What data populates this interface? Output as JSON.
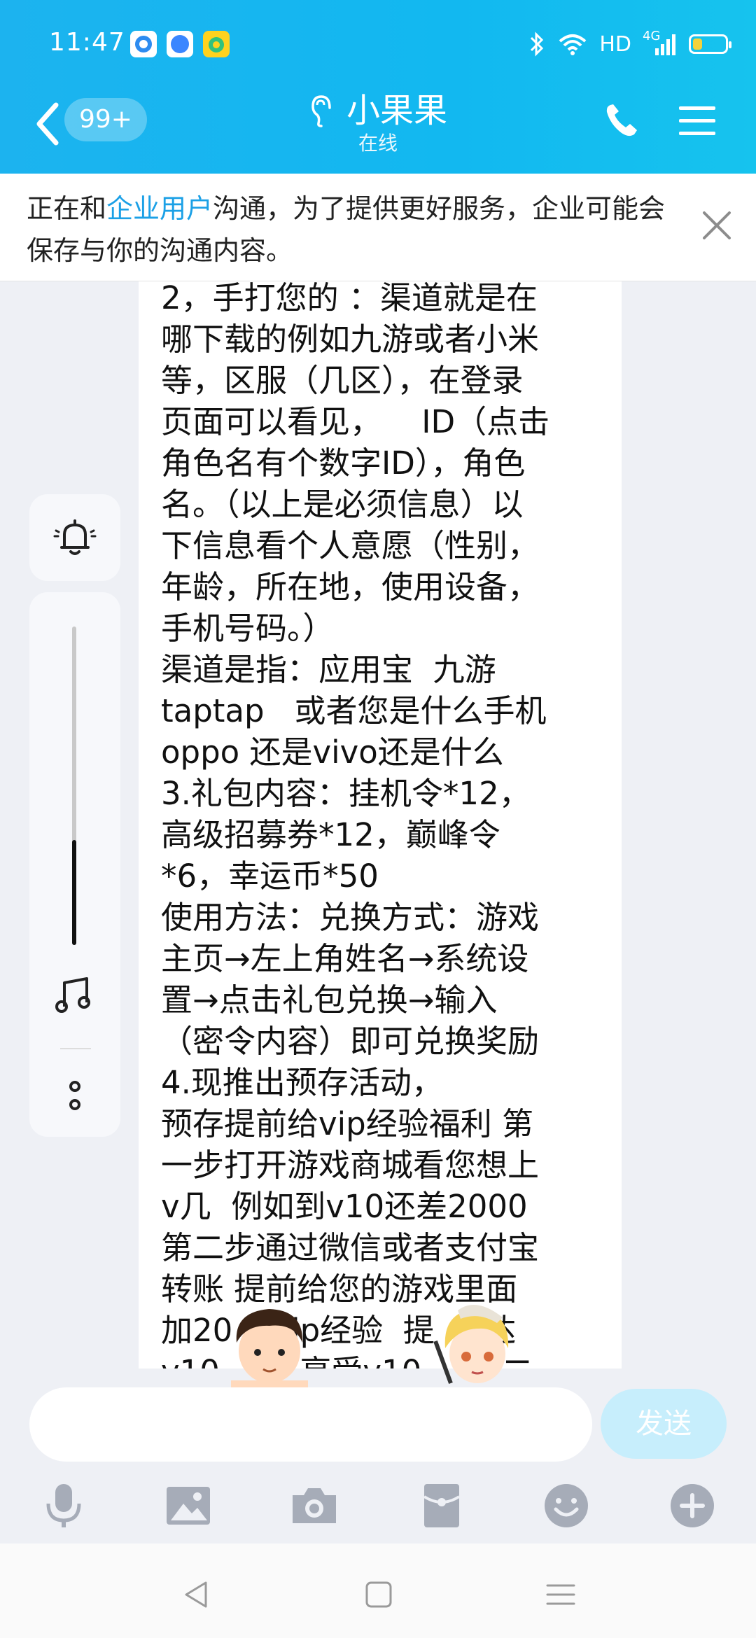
{
  "status_bar": {
    "time": "11:47",
    "hd": "HD",
    "network": "4G",
    "battery_level": 0.3,
    "icons": [
      "browser-app-icon",
      "compass-app-icon",
      "music-app-icon",
      "bluetooth-icon",
      "wifi-icon",
      "signal-icon",
      "battery-icon"
    ]
  },
  "header": {
    "unread_badge": "99+",
    "title": "小果果",
    "subtitle": "在线"
  },
  "notice": {
    "text_before": "正在和",
    "link": "企业用户",
    "text_after": "沟通，为了提供更好服务，企业可能会保存与你的沟通内容。"
  },
  "message": {
    "text": "2，手打您的 ：渠道就是在\n哪下载的例如九游或者小米\n等，区服（几区），在登录\n页面可以看见，    ID（点击\n角色名有个数字ID），角色\n名。（以上是必须信息）以\n下信息看个人意愿（性别，\n年龄，所在地，使用设备，\n手机号码。）\n渠道是指：应用宝  九游\ntaptap   或者您是什么手机\noppo 还是vivo还是什么\n3.礼包内容：挂机令*12，\n高级招募券*12，巅峰令\n*6，幸运币*50\n使用方法：兑换方式：游戏\n主页→左上角姓名→系统设\n置→点击礼包兑换→输入\n（密令内容）即可兑换奖励\n4.现推出预存活动，\n预存提前给vip经验福利 第\n一步打开游戏商城看您想上\nv几  例如到v10还差2000\n第二步通过微信或者支付宝\n转账 提前给您的游戏里面\n加20    vip经验  提     达\nv10        享受v10        二"
  },
  "side_controls": {
    "volume_level": 0.33
  },
  "input": {
    "value": "",
    "placeholder": "",
    "send_label": "发送"
  },
  "colors": {
    "header_gradient": "#1cb3ef",
    "link": "#1ba0e6",
    "send_disabled": "#c7eefc",
    "toolbar_icon": "#a6acb8"
  }
}
